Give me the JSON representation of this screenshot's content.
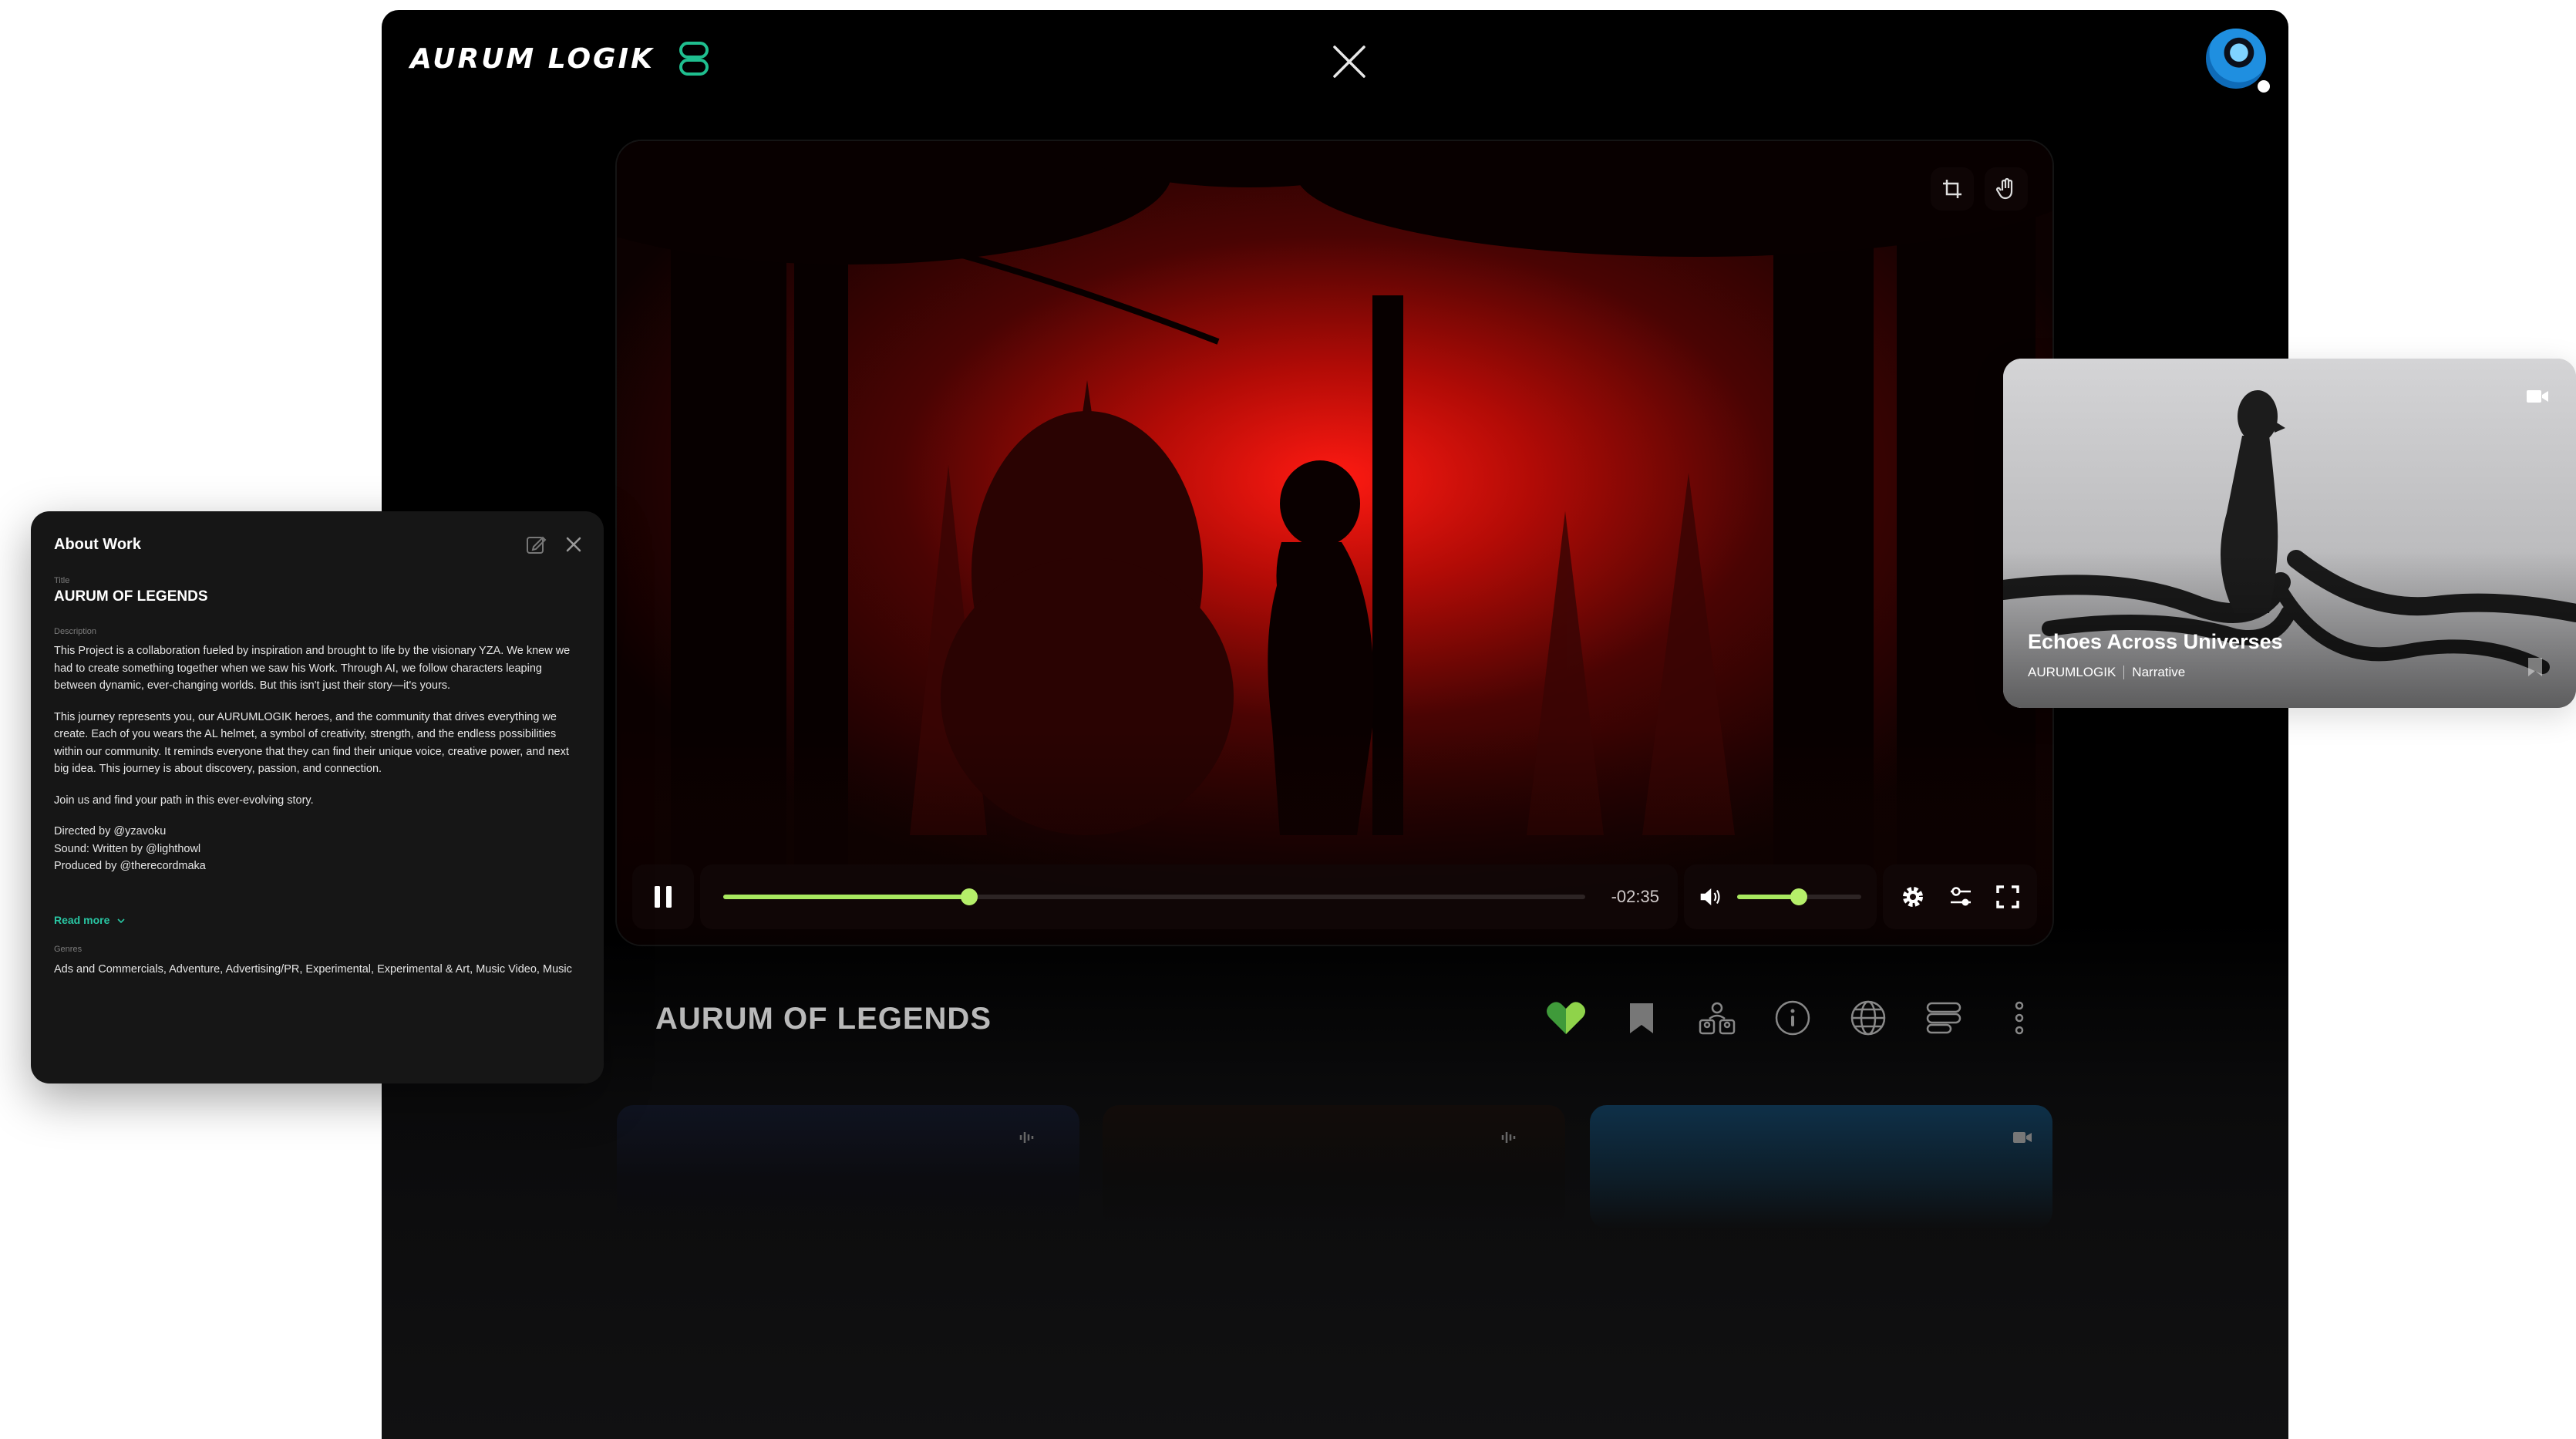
{
  "brand": {
    "name": "AURUM LOGIK"
  },
  "player": {
    "time_remaining": "-02:35",
    "progress_fraction": 0.285,
    "volume_fraction": 0.5
  },
  "work": {
    "title": "AURUM OF LEGENDS"
  },
  "actions": [
    "heart-icon",
    "bookmark-icon",
    "people-icon",
    "info-icon",
    "globe-icon",
    "list-icon",
    "more-icon"
  ],
  "about": {
    "header": "About Work",
    "title_label": "Title",
    "title": "AURUM OF LEGENDS",
    "description_label": "Description",
    "description_p1": "This Project is a collaboration fueled by inspiration and brought to life by the visionary YZA. We knew we had to create something together when we saw his Work. Through AI, we follow characters leaping between dynamic, ever-changing worlds. But this isn't just their story—it's yours.",
    "description_p2": "This journey represents you, our AURUMLOGIK heroes, and the community that drives everything we create. Each of you wears the AL helmet, a symbol of creativity, strength, and the endless possibilities within our community. It reminds everyone that they can find their unique voice, creative power, and next big idea. This journey is about discovery, passion, and connection.",
    "description_p3": "Join us and find your path in this ever-evolving story.",
    "credit_1": "Directed by @yzavoku",
    "credit_2": "Sound: Written by @lighthowl",
    "credit_3": "Produced by @therecordmaka",
    "read_more": "Read more",
    "genres_label": "Genres",
    "genres": "Ads and Commercials, Adventure, Advertising/PR, Experimental, Experimental & Art, Music Video, Music"
  },
  "card": {
    "title": "Echoes Across Universes",
    "author": "AURUMLOGIK",
    "category": "Narrative"
  },
  "colors": {
    "accent": "#a9e85f",
    "link": "#29c6a3",
    "brand_icon": "#1fbf8f"
  }
}
